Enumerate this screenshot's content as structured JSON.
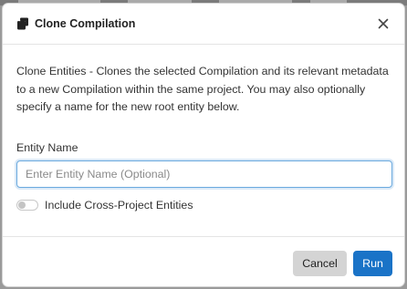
{
  "dialog": {
    "title": "Clone Compilation",
    "icon": "copy-icon",
    "close_icon": "close-icon",
    "description": "Clone Entities  -  Clones the selected Compilation and its relevant metadata to a new Compilation within the same project. You may also optionally specify a name for the new root entity below."
  },
  "form": {
    "entity_name_label": "Entity Name",
    "entity_name_placeholder": "Enter Entity Name (Optional)",
    "entity_name_value": "",
    "cross_project_label": "Include Cross-Project Entities",
    "cross_project_enabled": false
  },
  "footer": {
    "cancel_label": "Cancel",
    "run_label": "Run"
  },
  "colors": {
    "primary": "#1a73c7",
    "input_focus_border": "#6aa9de",
    "cancel_bg": "#d4d4d4"
  }
}
